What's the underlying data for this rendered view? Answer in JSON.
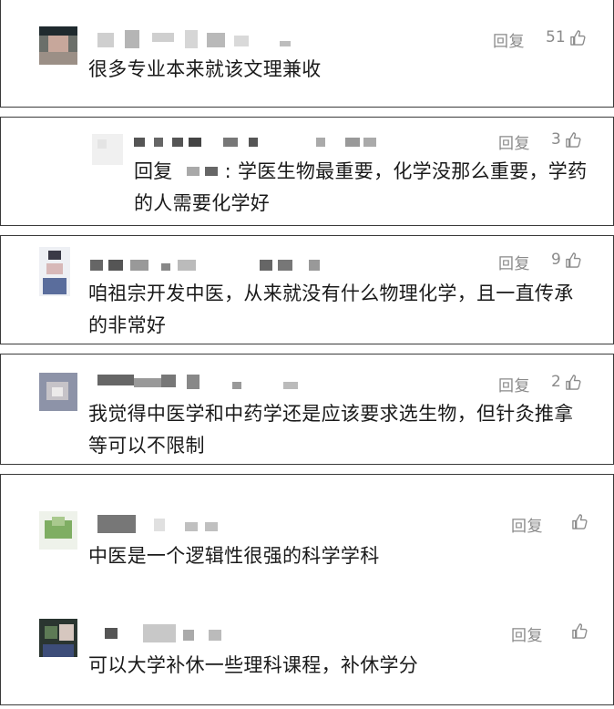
{
  "comments": [
    {
      "reply_label": "回复",
      "likes": "51",
      "text": "很多专业本来就该文理兼收"
    },
    {
      "reply_label": "回复",
      "likes": "3",
      "reply_prefix": "回复",
      "text": "学医生物最重要，化学没那么重要，学药的人需要化学好"
    },
    {
      "reply_label": "回复",
      "likes": "9",
      "text": "咱祖宗开发中医，从来就没有什么物理化学，且一直传承的非常好"
    },
    {
      "reply_label": "回复",
      "likes": "2",
      "text": "我觉得中医学和中药学还是应该要求选生物，但针灸推拿等可以不限制"
    },
    {
      "reply_label": "回复",
      "likes": "",
      "text": "中医是一个逻辑性很强的科学学科"
    },
    {
      "reply_label": "回复",
      "likes": "",
      "text": "可以大学补休一些理科课程，补休学分"
    }
  ],
  "colors": {
    "border": "#3a3a3a",
    "meta_text": "#8a8a8a",
    "body_text": "#1a1a1a"
  },
  "icons": {
    "like": "thumbs-up-icon"
  }
}
